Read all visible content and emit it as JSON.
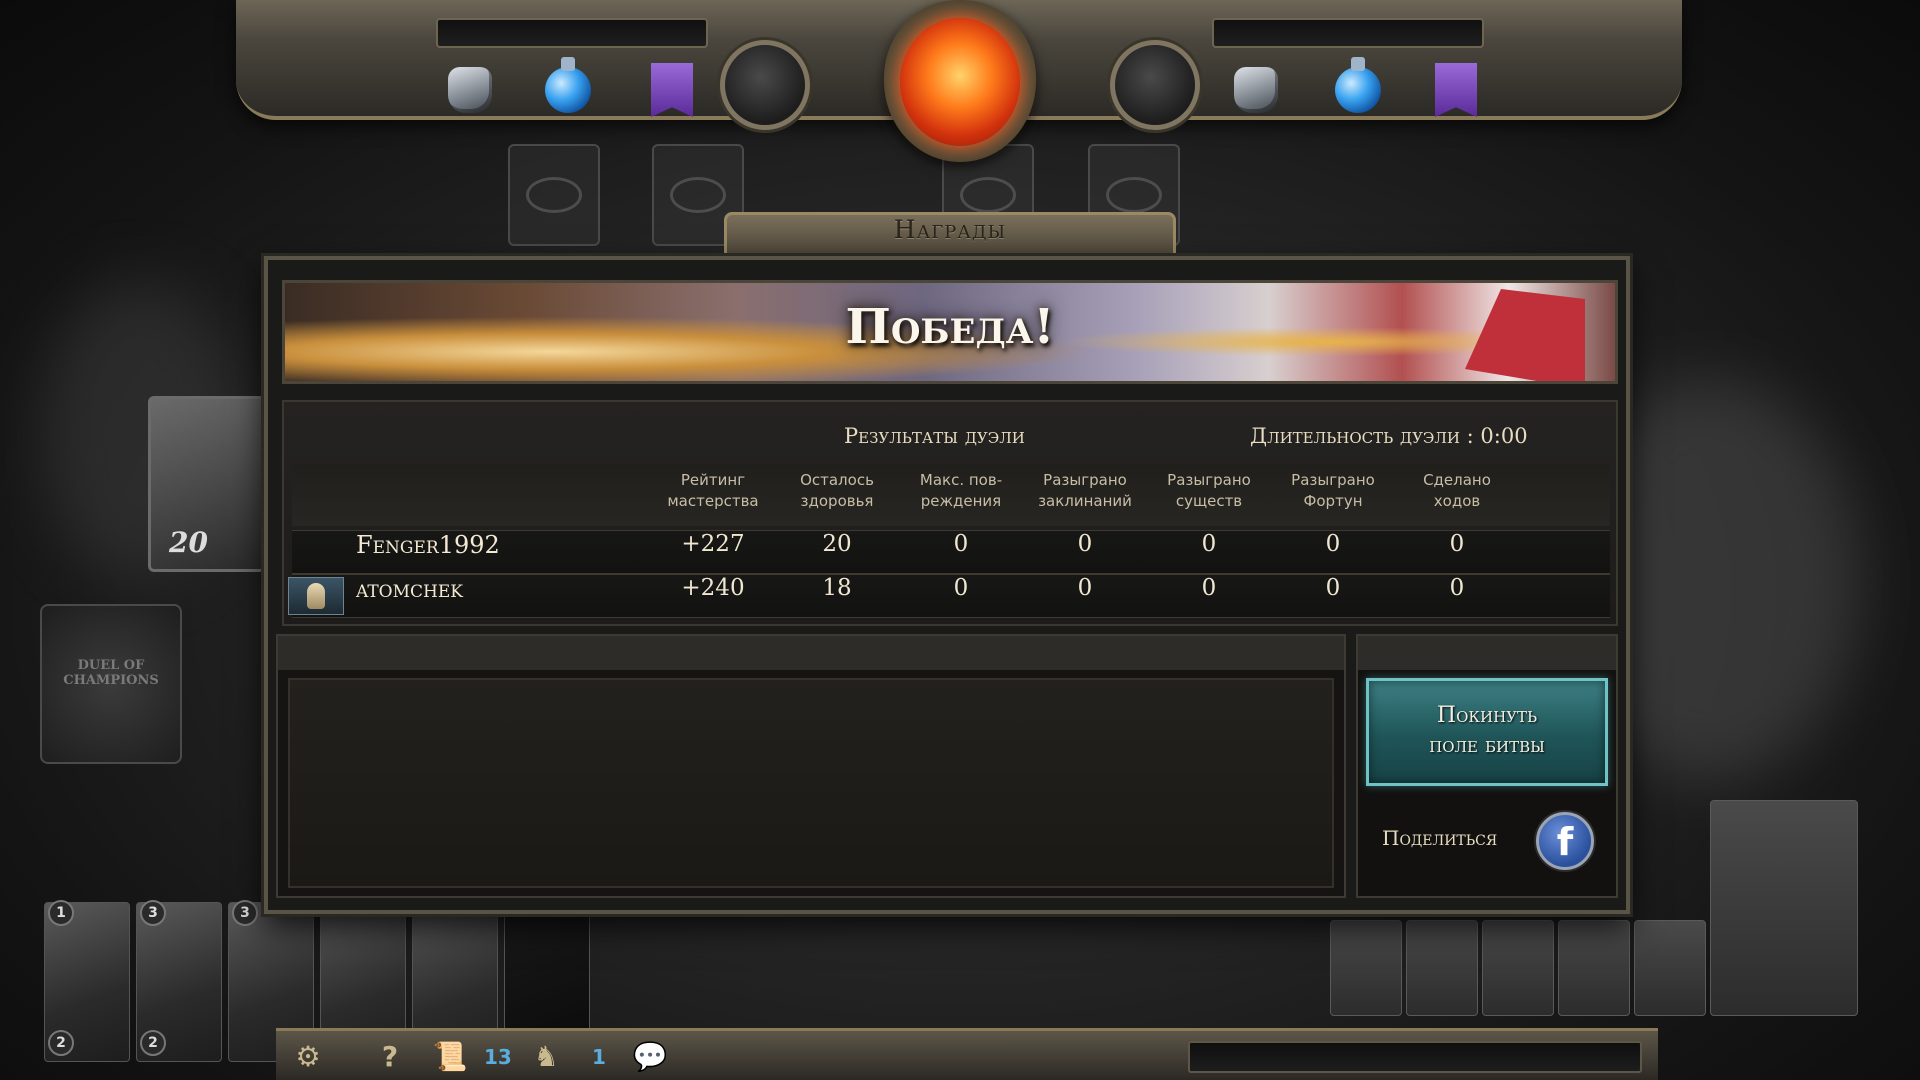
{
  "rewards_tab": {
    "title": "Награды"
  },
  "banner": {
    "title": "Победа!"
  },
  "results": {
    "heading": "Результаты дуэли",
    "duration_label": "Длительность дуэли : 0:00",
    "columns": [
      "Рейтинг мастерства",
      "Осталось здоровья",
      "Макс. пов-реждения",
      "Разыграно заклинаний",
      "Разыграно существ",
      "Разыграно Фортун",
      "Сделано ходов"
    ],
    "rows": [
      {
        "player": "Fenger1992",
        "values": [
          "+227",
          "20",
          "0",
          "0",
          "0",
          "0",
          "0"
        ]
      },
      {
        "player": "atomchek",
        "values": [
          "+240",
          "18",
          "0",
          "0",
          "0",
          "0",
          "0"
        ]
      }
    ]
  },
  "actions": {
    "leave_line1": "Покинуть",
    "leave_line2": "поле битвы",
    "share_label": "Поделиться",
    "facebook_glyph": "f"
  },
  "board": {
    "left_card_value": "20",
    "hand_badges": [
      "1",
      "3",
      "3"
    ],
    "hand_badges_bottom": [
      "2",
      "2"
    ],
    "deck_text": "DUEL OF CHAMPIONS"
  },
  "bottom_bar": {
    "settings_icon": "gear-icon",
    "help_glyph": "?",
    "scroll_count": "13",
    "hero_count": "1"
  },
  "colors": {
    "accent_teal": "#1f5558",
    "border_gold": "#8a7a58",
    "sun_orange": "#ff7a1a"
  }
}
